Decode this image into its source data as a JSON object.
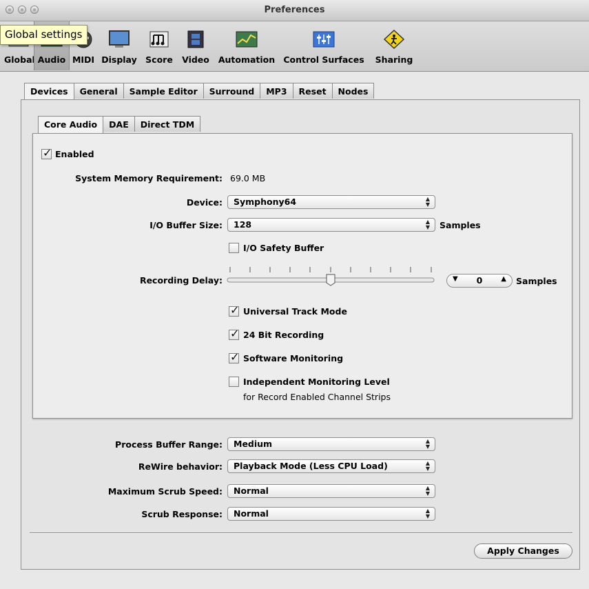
{
  "window": {
    "title": "Preferences"
  },
  "tooltip": {
    "text": "Global settings"
  },
  "toolbar": {
    "items": [
      {
        "label": "Global"
      },
      {
        "label": "Audio"
      },
      {
        "label": "MIDI"
      },
      {
        "label": "Display"
      },
      {
        "label": "Score"
      },
      {
        "label": "Video"
      },
      {
        "label": "Automation"
      },
      {
        "label": "Control Surfaces"
      },
      {
        "label": "Sharing"
      }
    ],
    "selected": "Audio"
  },
  "main_tabs": [
    "Devices",
    "General",
    "Sample Editor",
    "Surround",
    "MP3",
    "Reset",
    "Nodes"
  ],
  "sub_tabs": [
    "Core Audio",
    "DAE",
    "Direct TDM"
  ],
  "core_audio": {
    "enabled_label": "Enabled",
    "sys_mem_label": "System Memory Requirement:",
    "sys_mem_value": "69.0 MB",
    "device_label": "Device:",
    "device_value": "Symphony64",
    "buffer_label": "I/O Buffer Size:",
    "buffer_value": "128",
    "buffer_unit": "Samples",
    "safety_label": "I/O Safety Buffer",
    "delay_label": "Recording Delay:",
    "delay_value": "0",
    "delay_unit": "Samples",
    "utm_label": "Universal Track Mode",
    "bit24_label": "24 Bit Recording",
    "swmon_label": "Software Monitoring",
    "indep_label": "Independent Monitoring Level",
    "indep_sub": "for Record Enabled Channel Strips"
  },
  "bottom": {
    "pbr_label": "Process Buffer Range:",
    "pbr_value": "Medium",
    "rewire_label": "ReWire behavior:",
    "rewire_value": "Playback Mode (Less CPU Load)",
    "scrub_speed_label": "Maximum Scrub Speed:",
    "scrub_speed_value": "Normal",
    "scrub_resp_label": "Scrub Response:",
    "scrub_resp_value": "Normal",
    "apply_label": "Apply Changes"
  }
}
